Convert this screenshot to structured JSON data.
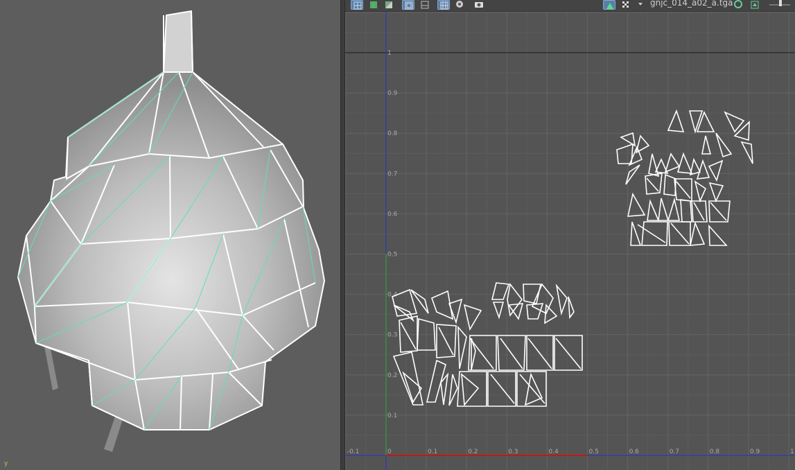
{
  "viewport": {
    "axis_label": "y"
  },
  "uv_editor": {
    "texture_name": "gnjc_014_a02_a.tga",
    "toolbar_icons": [
      "uv-grid-icon",
      "uv-shaded-icon",
      "uv-checker-icon",
      "uv-frame-icon",
      "uv-layout-icon",
      "uv-snap-grid-icon",
      "uv-iso-select-icon",
      "uv-snapshot-icon"
    ],
    "right_icons": [
      "display-image-icon",
      "checker-toggle-icon",
      "texture-menu-chevron-icon",
      "texture-refresh-icon",
      "texture-prev-icon",
      "exposure-slider-icon"
    ],
    "u_ticks": [
      "-0.1",
      "0",
      "0.1",
      "0.2",
      "0.3",
      "0.4",
      "0.5",
      "0.6",
      "0.7",
      "0.8",
      "0.9",
      "1"
    ],
    "v_ticks": [
      "0.1",
      "0.2",
      "0.3",
      "0.4",
      "0.5",
      "0.6",
      "0.7",
      "0.8",
      "0.9",
      "1"
    ],
    "colors": {
      "u_axis": "#c01818",
      "v_axis": "#2bb02b",
      "frame": "#2233cc",
      "uv_edges": "#ffffff",
      "wire_edges": "#5fe0b8"
    }
  }
}
